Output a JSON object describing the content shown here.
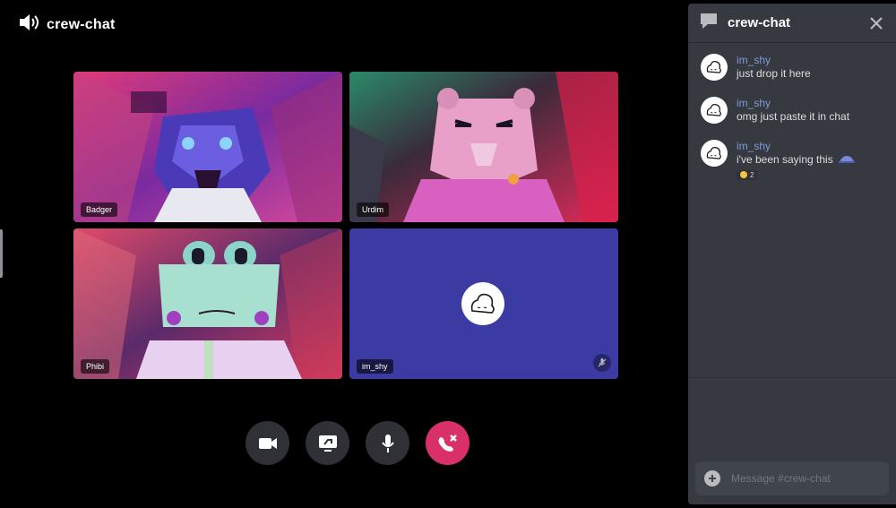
{
  "call": {
    "title": "crew-chat",
    "participants": [
      {
        "name": "Badger"
      },
      {
        "name": "Urdim"
      },
      {
        "name": "Phibi"
      },
      {
        "name": "im_shy"
      }
    ]
  },
  "controls": {
    "items": [
      "camera-icon",
      "screen-share-icon",
      "microphone-icon",
      "hang-up-icon"
    ],
    "hangup_color": "#d9306a"
  },
  "chat": {
    "title": "crew-chat",
    "messages": [
      {
        "author": "im_shy",
        "text": "just drop it here"
      },
      {
        "author": "im_shy",
        "text": "omg just paste it in chat"
      },
      {
        "author": "im_shy",
        "text": "i've been saying this",
        "reaction_count": "2"
      }
    ],
    "input_placeholder": "Message #crew-chat"
  },
  "colors": {
    "chat_bg": "#36393f",
    "author": "#7e9bd8",
    "empty_tile_bg": "#3c3ba3"
  }
}
